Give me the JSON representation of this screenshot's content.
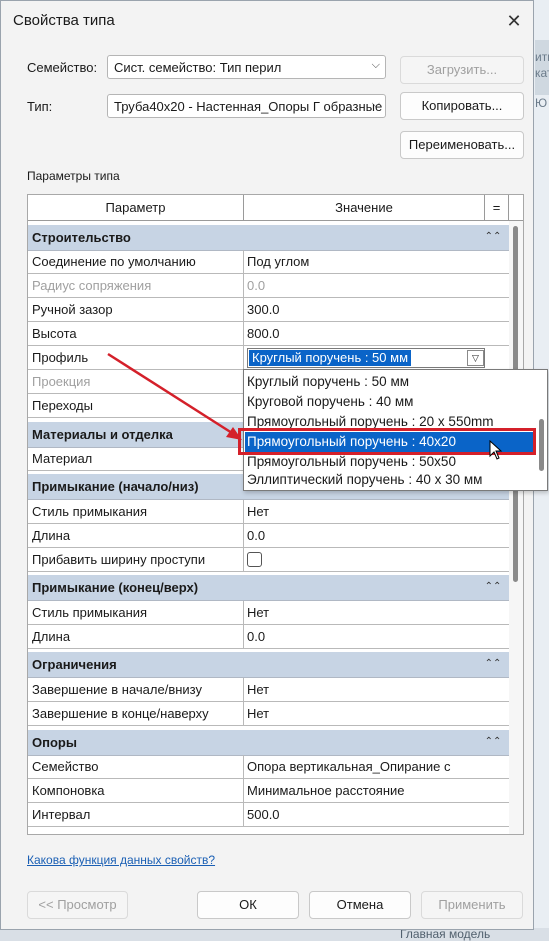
{
  "window": {
    "title": "Свойства типа"
  },
  "family": {
    "label": "Семейство:",
    "value": "Сист. семейство: Тип перил"
  },
  "type": {
    "label": "Тип:",
    "value": "Труба40х20 - Настенная_Опоры Г образные"
  },
  "buttons": {
    "load": "Загрузить...",
    "duplicate": "Копировать...",
    "rename": "Переименовать...",
    "preview": "<< Просмотр",
    "ok": "ОК",
    "cancel": "Отмена",
    "apply": "Применить"
  },
  "section_label": "Параметры типа",
  "grid": {
    "headers": {
      "param": "Параметр",
      "value": "Значение",
      "eq": "="
    },
    "groups": {
      "construction": "Строительство",
      "materials": "Материалы и отделка",
      "termination_start": "Примыкание (начало/низ)",
      "termination_end": "Примыкание (конец/верх)",
      "constraints": "Ограничения",
      "supports": "Опоры"
    },
    "rows": {
      "default_join": {
        "p": "Соединение по умолчанию",
        "v": "Под углом"
      },
      "fillet_radius": {
        "p": "Радиус сопряжения",
        "v": "0.0"
      },
      "hand_clearance": {
        "p": "Ручной зазор",
        "v": "300.0"
      },
      "height": {
        "p": "Высота",
        "v": "800.0"
      },
      "profile": {
        "p": "Профиль",
        "v": "Круглый поручень : 50 мм"
      },
      "projection": {
        "p": "Проекция"
      },
      "transitions": {
        "p": "Переходы"
      },
      "material": {
        "p": "Материал"
      },
      "start_style": {
        "p": "Стиль примыкания",
        "v": "Нет"
      },
      "start_length": {
        "p": "Длина",
        "v": "0.0"
      },
      "tread_width": {
        "p": "Прибавить ширину проступи"
      },
      "end_style": {
        "p": "Стиль примыкания",
        "v": "Нет"
      },
      "end_length": {
        "p": "Длина",
        "v": "0.0"
      },
      "finish_start": {
        "p": "Завершение в начале/внизу",
        "v": "Нет"
      },
      "finish_end": {
        "p": "Завершение в конце/наверху",
        "v": "Нет"
      },
      "support_family": {
        "p": "Семейство",
        "v": "Опора вертикальная_Опирание с"
      },
      "layout": {
        "p": "Компоновка",
        "v": "Минимальное расстояние"
      },
      "spacing": {
        "p": "Интервал",
        "v": "500.0"
      }
    }
  },
  "dropdown_options": [
    "Круглый поручень : 50 мм",
    "Круговой поручень : 40 мм",
    "Прямоугольный поручень : 20 x 550mm",
    "Прямоугольный поручень : 40х20",
    "Прямоугольный поручень : 50х50",
    "Эллиптический поручень : 40 x 30 мм"
  ],
  "help_link": "Какова функция данных свойств?",
  "background": {
    "right_fragments": [
      "ить",
      "ката",
      "Ю"
    ],
    "bottom_text": "Главная модель"
  },
  "colors": {
    "group_header": "#c7d4e4",
    "selection": "#0a64c8",
    "annotation_red": "#d4202a"
  }
}
